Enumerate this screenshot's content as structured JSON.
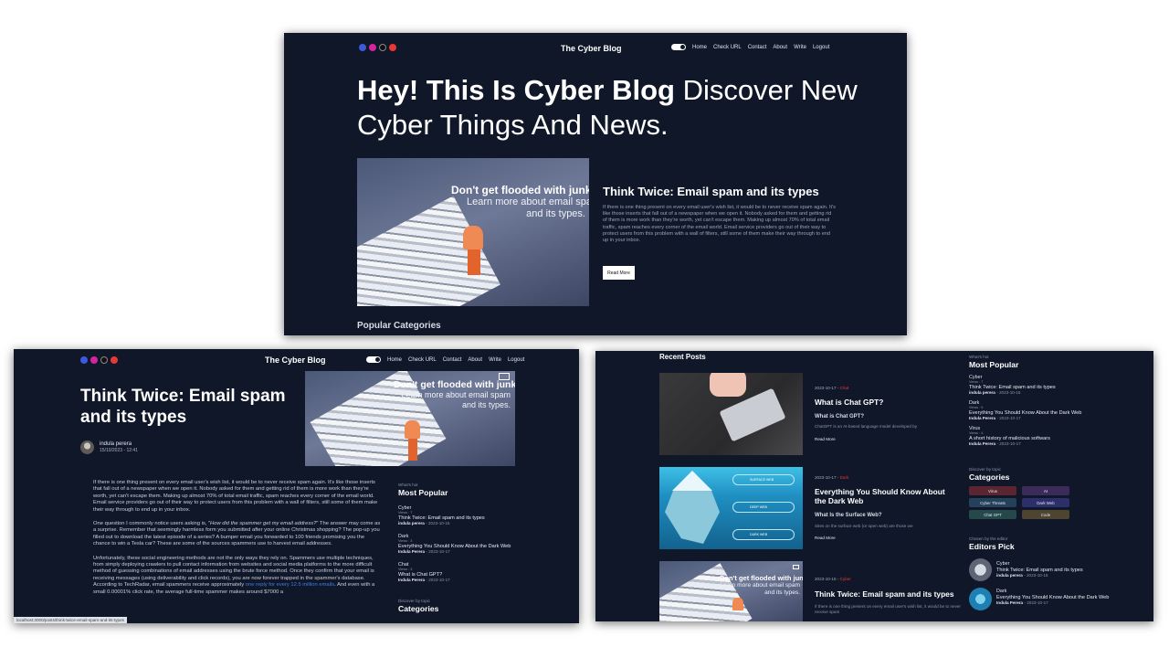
{
  "site": {
    "brand": "The Cyber Blog",
    "nav": [
      "Home",
      "Check URL",
      "Contact",
      "About",
      "Write",
      "Logout"
    ]
  },
  "home": {
    "hero_bold": "Hey! This Is Cyber Blog",
    "hero_rest": " Discover New Cyber Things And News.",
    "featured_image": {
      "line1": "Don't get flooded with junk!",
      "line2": "Learn more about email spam",
      "line3": "and its types."
    },
    "featured_title": "Think Twice: Email spam and its types",
    "featured_excerpt": "If there is one thing present on every email user's wish list, it would be to never receive spam again. It's like those inserts that fall out of a newspaper when we open it. Nobody asked for them and getting rid of them is more work than they're worth, yet can't escape them. Making up almost 70% of total email traffic, spam reaches every corner of the email world. Email service providers go out of their way to protect users from this problem with a wall of filters, still some of them make their way through to end up in your inbox.",
    "read_more": "Read More",
    "popular_categories": "Popular Categories"
  },
  "article": {
    "title": "Think Twice: Email spam and its types",
    "author": "indula perera",
    "date": "15/10/2023 - 12:41",
    "p1": "If there is one thing present on every email user's wish list, it would be to never receive spam again. It's like those inserts that fall out of a newspaper when we open it. Nobody asked for them and getting rid of them is more work than they're worth, yet can't escape them. Making up almost 70% of total email traffic, spam reaches every corner of the email world. Email service providers go out of their way to protect users from this problem with a wall of filters, still some of them make their way through to end up in your inbox.",
    "p2_a": "One question I commonly notice users asking is, \"",
    "p2_em": "How did the spammer get my email address?",
    "p2_b": "\" The answer may come as a surprise. Remember that seemingly harmless form you submitted after your online Christmas shopping? The pop-up you filled out to download the latest episode of a series? A bumper email you forwarded to 100 friends promising you the chance to win a Tesla car? These are some of the sources spammers use to harvest email addresses.",
    "p3_a": "Unfortunately, these social engineering methods are not the only ways they rely on. Spammers use multiple techniques, from simply deploying crawlers to pull contact information from websites and social media platforms to the more difficult method of guessing combinations of email addresses using the brute force method. Once they confirm that your email is receiving messages (using deliverability and click records), you are now forever trapped in the spammer's database. According to TechRadar, email spammers receive approximately ",
    "p3_link": "one reply for every 12.5 million emails",
    "p3_b": ". And even with a small 0.00001% click rate, the average full-time spammer makes around $7000 a",
    "status_url": "localhost:3000/posts/think-twice-email-spam-and-its-types"
  },
  "sidebar": {
    "whats_hot": "What's hot",
    "most_popular": "Most Popular",
    "popular": [
      {
        "category": "Cyber",
        "views": "Views : 7",
        "title": "Think Twice: Email spam and its types",
        "author": "indula perera",
        "date": "2023-10-15"
      },
      {
        "category": "Dark",
        "views": "Views : 3",
        "title": "Everything You Should Know About the Dark Web",
        "author": "Indula Perera",
        "date": "2023-10-17"
      },
      {
        "category": "Chat",
        "views": "Views : 3",
        "title": "What is Chat GPT?",
        "author": "Indula Perera",
        "date": "2023-10-17"
      }
    ],
    "popular_p3": [
      {
        "category": "Cyber",
        "views": "Views : 7",
        "title": "Think Twice: Email spam and its types",
        "author": "indula perera",
        "date": "2023-10-15"
      },
      {
        "category": "Dark",
        "views": "Views : 5",
        "title": "Everything You Should Know About the Dark Web",
        "author": "Indula Perera",
        "date": "2023-10-17"
      },
      {
        "category": "Virus",
        "views": "Views : 4",
        "title": "A short history of malicious softwars",
        "author": "Indula Perera",
        "date": "2023-10-17"
      }
    ],
    "discover_by_topic": "Discover by topic",
    "categories_head": "Categories",
    "categories_partial": "Categories",
    "categories": [
      "Virus",
      "AI",
      "Cyber Threats",
      "Dark Web",
      "Chat GPT",
      "Code"
    ],
    "chosen_by_editor": "Chosen by the editor",
    "editors_pick": "Editors Pick",
    "editors": [
      {
        "category": "Cyber",
        "title": "Think Twice: Email spam and its types",
        "author": "indula perera",
        "date": "2023-10-15"
      },
      {
        "category": "Dark",
        "title": "Everything You Should Know About the Dark Web",
        "author": "Indula Perera",
        "date": "2023-10-17"
      }
    ]
  },
  "recent": {
    "heading": "Recent Posts",
    "posts": [
      {
        "date": "2023-10-17",
        "category": "Chat",
        "title": "What is Chat GPT?",
        "subtitle": "What is Chat GPT?",
        "excerpt": "ChatGPT is an AI-based language model developed by",
        "read_more": "Read More"
      },
      {
        "date": "2023-10-17",
        "category": "Dark",
        "title": "Everything You Should Know About the Dark Web",
        "subtitle": "What Is the Surface Web?",
        "excerpt": "Sites on the surface web (or open web) are those we",
        "read_more": "Read More"
      },
      {
        "date": "2023-10-15",
        "category": "Cyber",
        "title": "Think Twice: Email spam and its types",
        "subtitle": "",
        "excerpt": "If there is one thing present on every email user's wish list, it would be to never receive spam",
        "read_more": ""
      }
    ],
    "iceberg_labels": [
      "SURFACE WEB",
      "DEEP WEB",
      "DARK WEB"
    ],
    "thumb_ad": {
      "line1": "Don't get flooded with junk!",
      "line2": "Learn more about email spam",
      "line3": "and its types."
    }
  },
  "colors": {
    "background": "#0f1729",
    "accent_red": "#e53935",
    "link_blue": "#3f7fe8"
  }
}
